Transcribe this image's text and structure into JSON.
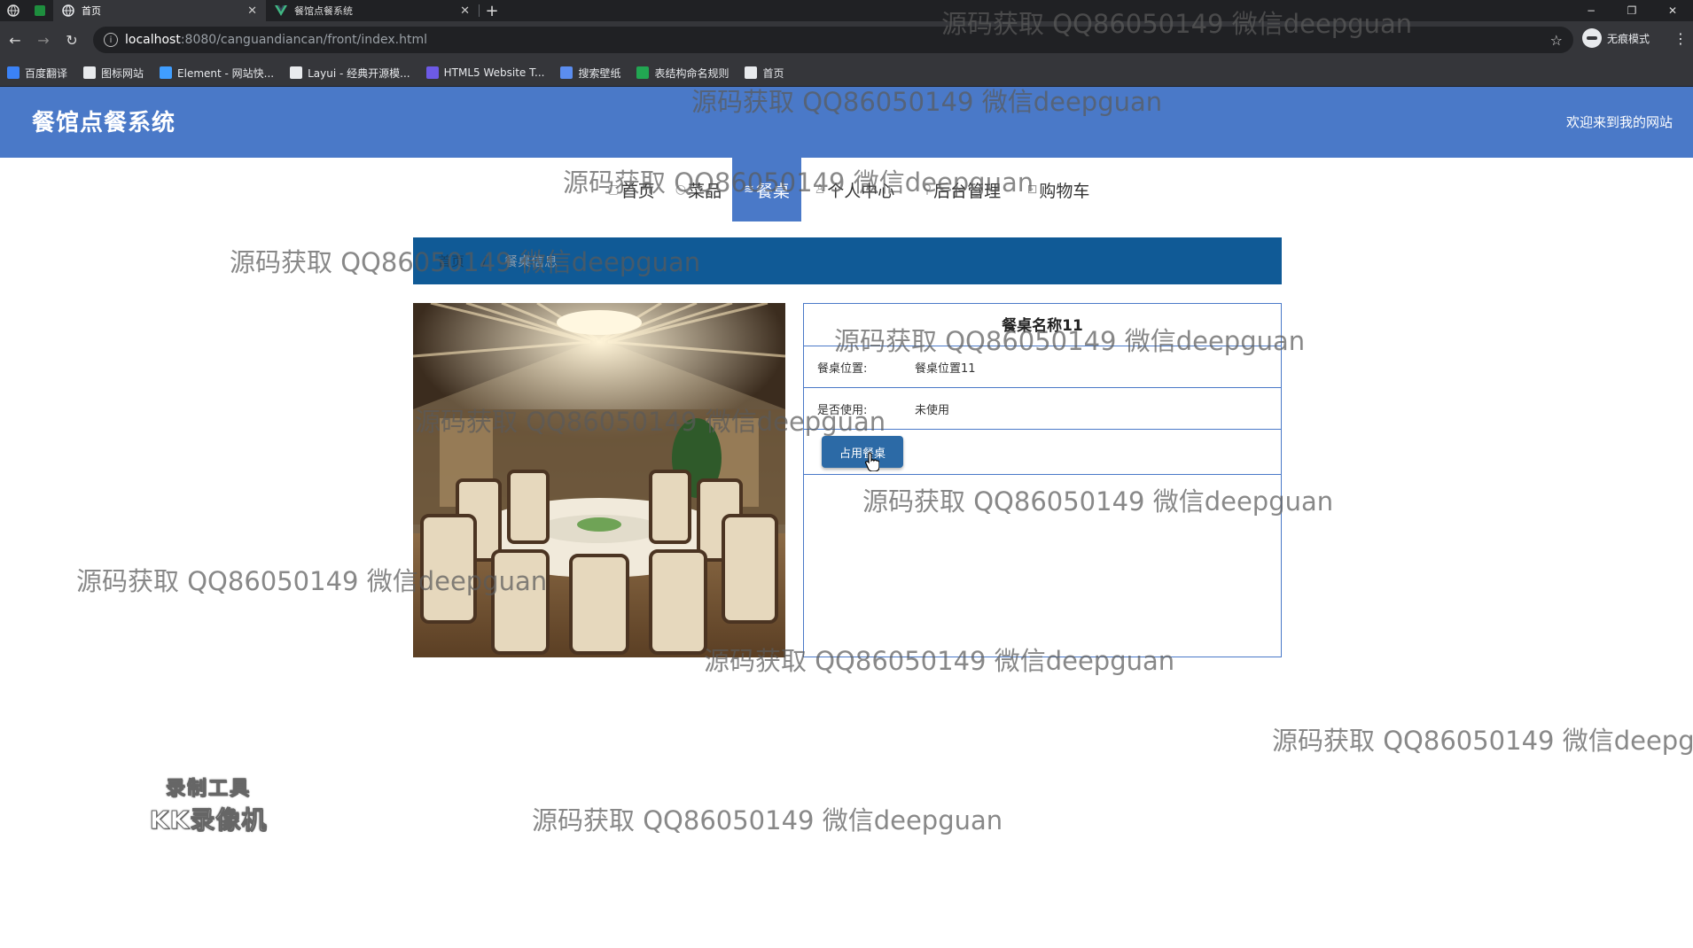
{
  "browser": {
    "tabs": [
      {
        "title": "首页",
        "active": true
      },
      {
        "title": "餐馆点餐系统",
        "active": false
      }
    ],
    "new_tab": "+",
    "url": {
      "host": "localhost",
      "port_path": ":8080/canguandiancan/front/index.html"
    },
    "profile_label": "无痕模式",
    "window_controls": {
      "minimize": "−",
      "restore": "❐",
      "close": "✕"
    },
    "nav": {
      "back": "←",
      "forward": "→",
      "reload": "↻"
    },
    "bookmarks": [
      {
        "label": "百度翻译",
        "color": "#3b82f6"
      },
      {
        "label": "图标网站",
        "color": "#e8eaed"
      },
      {
        "label": "Element - 网站快...",
        "color": "#409eff"
      },
      {
        "label": "Layui - 经典开源模...",
        "color": "#e8eaed"
      },
      {
        "label": "HTML5 Website T...",
        "color": "#6d5ae6"
      },
      {
        "label": "搜索壁纸",
        "color": "#5b8def"
      },
      {
        "label": "表结构命名规则",
        "color": "#22a652"
      },
      {
        "label": "首页",
        "color": "#e8eaed"
      }
    ]
  },
  "site": {
    "title": "餐馆点餐系统",
    "welcome": "欢迎来到我的网站",
    "accent": "#4a79c8",
    "nav": [
      {
        "label": "首页",
        "icon": "▢",
        "active": false
      },
      {
        "label": "菜品",
        "icon": "○",
        "active": false
      },
      {
        "label": "餐桌",
        "icon": "≋",
        "active": true
      },
      {
        "label": "个人中心",
        "icon": "♙",
        "active": false
      },
      {
        "label": "后台管理",
        "icon": "⚲",
        "active": false
      },
      {
        "label": "购物车",
        "icon": "⊡",
        "active": false
      }
    ],
    "breadcrumb": {
      "home": "首页",
      "separator": "/",
      "current": "餐桌信息"
    }
  },
  "detail": {
    "name": "餐桌名称11",
    "fields": [
      {
        "label": "餐桌位置:",
        "value": "餐桌位置11"
      },
      {
        "label": "是否使用:",
        "value": "未使用"
      }
    ],
    "action_label": "占用餐桌"
  },
  "recorder": {
    "line1": "录制工具",
    "line2": "KK录像机"
  },
  "watermark": {
    "text": "源码获取 QQ86050149 微信deepguan"
  }
}
